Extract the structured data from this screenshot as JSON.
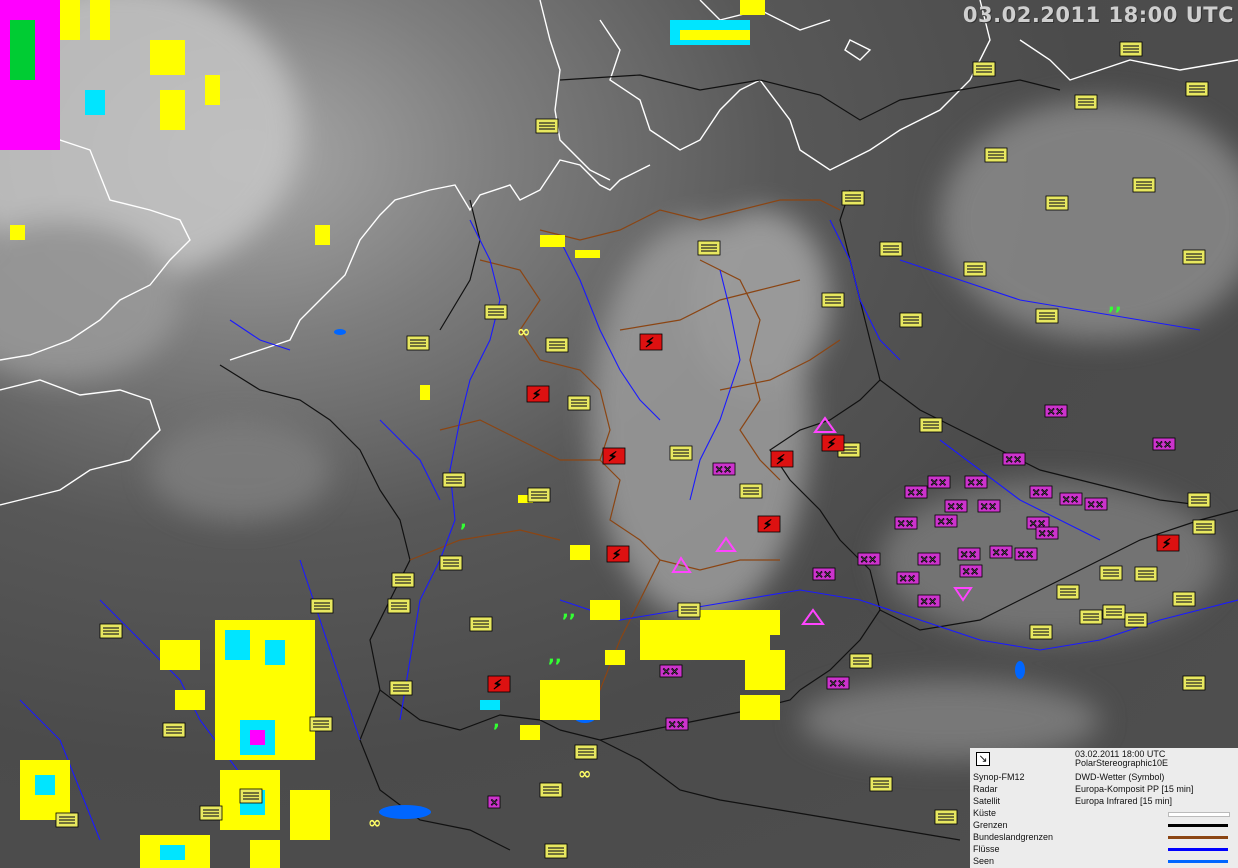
{
  "timestamp": "03.02.2011 18:00 UTC",
  "legend": {
    "date": "03.02.2011 18:00 UTC",
    "projection": "PolarStereographic10E",
    "layers": [
      {
        "name": "Synop-FM12",
        "description": "DWD-Wetter (Symbol)"
      },
      {
        "name": "Radar",
        "description": "Europa-Komposit PP [15 min]"
      },
      {
        "name": "Satellit",
        "description": "Europa Infrared [15 min]"
      }
    ],
    "line_layers": [
      {
        "name": "Küste",
        "color": "#ffffff"
      },
      {
        "name": "Grenzen",
        "color": "#000000"
      },
      {
        "name": "Bundeslandgrenzen",
        "color": "#8b4513"
      },
      {
        "name": "Flüsse",
        "color": "#0000ff"
      },
      {
        "name": "Seen",
        "color": "#0066ff"
      }
    ]
  },
  "colors": {
    "coast": "#ffffff",
    "border": "#111111",
    "state_border": "#8b4513",
    "river": "#1a1aff",
    "radar_low": "#ffff00",
    "radar_mid": "#00e5ff",
    "radar_high": "#ff00ff",
    "radar_green": "#00cc33",
    "fog_symbol": "#ffff66",
    "snow_symbol": "#ff44ff",
    "rain_symbol": "#33ff33",
    "thunder_symbol": "#ff2020"
  },
  "symbol_types": [
    "fog",
    "snow",
    "rain",
    "drizzle",
    "snow-shower",
    "thunder",
    "haze"
  ]
}
